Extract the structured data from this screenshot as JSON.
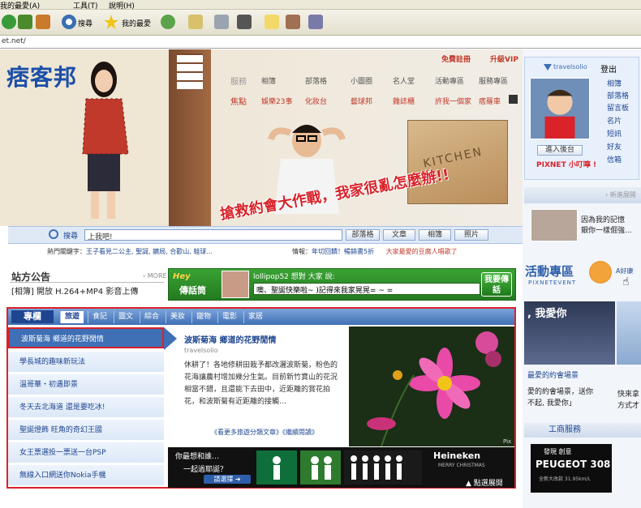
{
  "browser": {
    "menu": {
      "favorites": "我的最愛(A)",
      "tools": "工具(T)",
      "help": "說明(H)"
    },
    "toolbar": {
      "search": "搜尋",
      "favorites": "我的最愛"
    },
    "address": "et.net/"
  },
  "site": {
    "logo": "痞客邦",
    "register": "免費註冊",
    "vip": "升級VIP",
    "service_label": "服務",
    "services": [
      "相簿",
      "部落格",
      "小圖圈",
      "名人堂",
      "活動專區",
      "服務專區"
    ],
    "focus_label": "焦點",
    "focus": [
      "娛樂23事",
      "化妝台",
      "藝球邦",
      "雜誌櫃",
      "許我一個家",
      "痞羅車"
    ],
    "headline": "搶救約會大作戰，我家很亂怎麼辦!!",
    "box_text": "KITCHEN"
  },
  "search": {
    "label": "搜尋",
    "value": "上我吧!",
    "buttons": [
      "部落格",
      "文章",
      "相簿",
      "照片"
    ],
    "hot_label": "熱門關鍵字：",
    "hot_keywords": "王子看見二公主, 聖誕, 鑣局, 合歡山, 蛙球...",
    "info_label": "情報：",
    "info_items": [
      "年切回饋！暢銷書5折",
      "大家最愛的豆腐人唱歌了"
    ]
  },
  "announcement": {
    "title": "站方公告",
    "more": "› MORE",
    "text": "[相簿] 開放 H.264+MP4 影音上傳"
  },
  "chat": {
    "hey": "Hey",
    "talk": "傳話筒",
    "user": "lollipop52 想對 大家 說:",
    "message": "噢、聖誕快樂啦~ )記得來我家晃晃= ~ =",
    "send": "我要傳話"
  },
  "feature": {
    "title": "專欄",
    "tabs": [
      "旅遊",
      "食記",
      "圖文",
      "綜合",
      "美妝",
      "寵物",
      "電影",
      "家居"
    ],
    "side_items": [
      "波斯菊海 鄉道的花野閒情",
      "學長城的趣味新玩法",
      "溫哥華・初遇即景",
      "冬天去北海道 還是要吃冰!",
      "聖誕燈飾 旺角的奇幻王國",
      "女王票選投一票送一台PSP",
      "無線入口網送你Nokia手機"
    ],
    "article": {
      "title": "波斯菊海 鄉道的花野閒情",
      "author": "travelsolio",
      "body": "休耕了！各地修耕田栽予都改灑波斯菊，粉色的花海讓農村增加幾分生氣。目前新竹寶山的花況相當不錯，且還能下去田中，近距離的賞花拍花，和波斯菊有近距離的接觸…",
      "links": "《看更多旅遊分類文章》《繼續閱讀》"
    },
    "photo_credit": "Pix",
    "ad": {
      "line1": "你最想和誰…",
      "line2": "一起過耶誕？",
      "button": "請選擇 ➜",
      "brand": "Heineken",
      "subtitle": "MERRY CHRISTMAS",
      "select": "▲ 點選展開"
    }
  },
  "right": {
    "brand": "travelsolio",
    "logout": "登出",
    "links": [
      "相簿",
      "部落格",
      "留言板",
      "名片",
      "短訊",
      "好友",
      "信箱"
    ],
    "backstage": "進入後台",
    "tel": "PIXNET 小叮嚀 !",
    "latest": "› 新進展開",
    "latest_text": [
      "因為我的記憶",
      "銀你一樣倔強..."
    ],
    "event_title": "活動專區",
    "event_sub": "PIXNETEVENT",
    "agood": "A好康",
    "event_banner": ", 我愛你",
    "event_t1": "最愛的約會場景",
    "event_t2": [
      "愛的約會場景，送你",
      "不起, 我愛你」"
    ],
    "event_t3": [
      "快來拿",
      "方式才"
    ],
    "biz": "工商服務",
    "peugeot": [
      "發現 創意",
      "PEUGEOT 308",
      "全新大改款 31.95km/L"
    ]
  }
}
